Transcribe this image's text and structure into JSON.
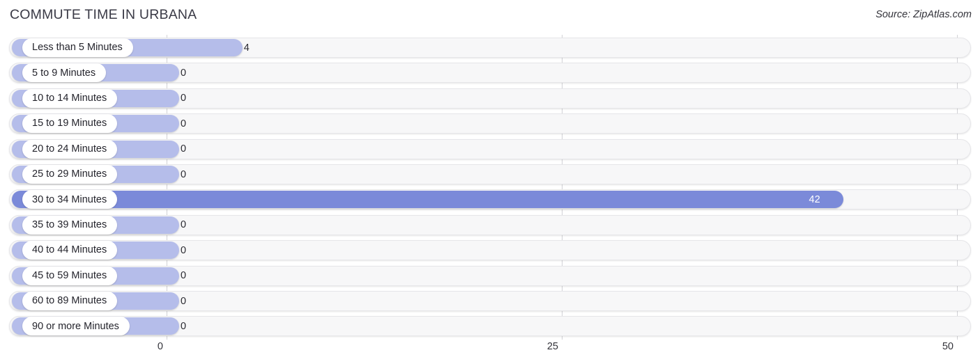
{
  "header": {
    "title": "COMMUTE TIME IN URBANA",
    "source": "Source: ZipAtlas.com"
  },
  "chart_data": {
    "type": "bar",
    "orientation": "horizontal",
    "title": "COMMUTE TIME IN URBANA",
    "subtitle": "",
    "xlabel": "",
    "ylabel": "",
    "xlim": [
      0,
      50
    ],
    "xticks": [
      0,
      25,
      50
    ],
    "xtick_labels": [
      "0",
      "25",
      "50"
    ],
    "grid": true,
    "legend": false,
    "categories": [
      "Less than 5 Minutes",
      "5 to 9 Minutes",
      "10 to 14 Minutes",
      "15 to 19 Minutes",
      "20 to 24 Minutes",
      "25 to 29 Minutes",
      "30 to 34 Minutes",
      "35 to 39 Minutes",
      "40 to 44 Minutes",
      "45 to 59 Minutes",
      "60 to 89 Minutes",
      "90 or more Minutes"
    ],
    "values": [
      4,
      0,
      0,
      0,
      0,
      0,
      42,
      0,
      0,
      0,
      0,
      0
    ],
    "value_labels": [
      "4",
      "0",
      "0",
      "0",
      "0",
      "0",
      "42",
      "0",
      "0",
      "0",
      "0",
      "0"
    ],
    "highlight_index": 6,
    "colors": {
      "bar": "#b5bdea",
      "bar_highlight": "#7b8ad9",
      "track": "#f7f7f8",
      "gridline": "#d2d2d6",
      "text": "#33333a"
    }
  }
}
